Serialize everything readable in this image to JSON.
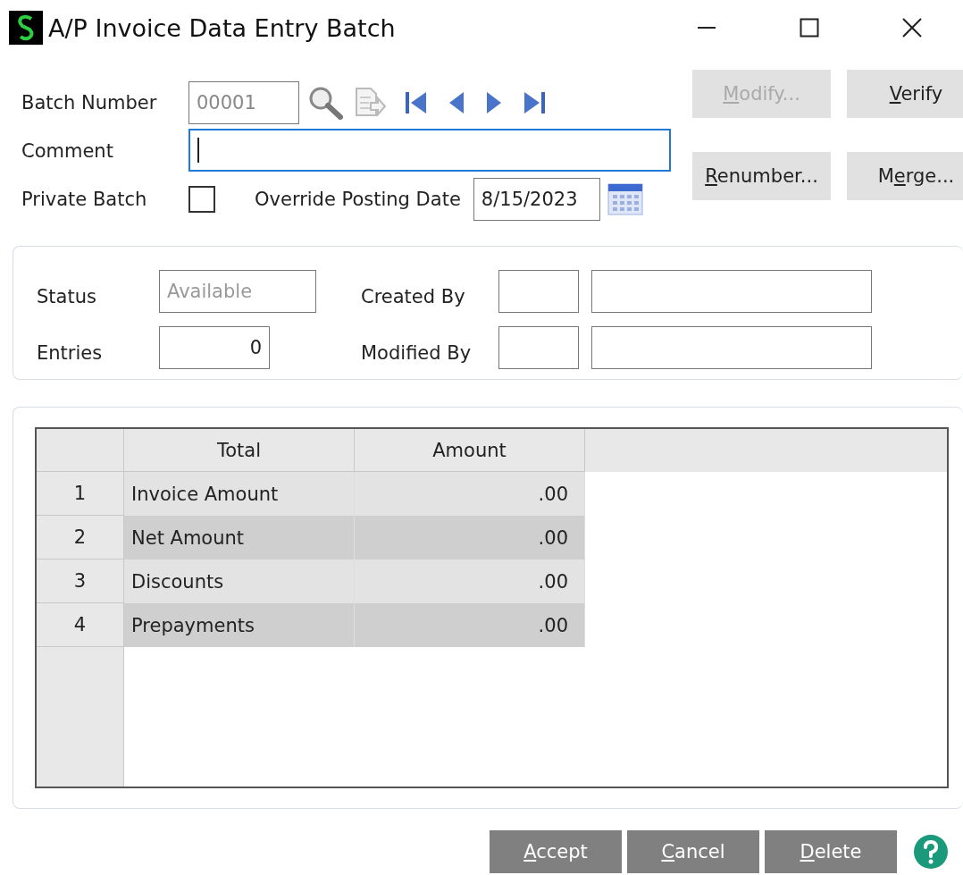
{
  "window": {
    "title": "A/P Invoice Data Entry Batch"
  },
  "header": {
    "batch_number": {
      "label": "Batch Number",
      "value": "00001"
    },
    "comment": {
      "label": "Comment"
    },
    "private_batch": {
      "label": "Private Batch",
      "checked": false
    },
    "override_posting_date": {
      "label": "Override Posting Date",
      "value": "8/15/2023"
    }
  },
  "side_buttons": [
    {
      "key": "M",
      "post": "odify...",
      "disabled": true
    },
    {
      "key": "V",
      "post": "erify",
      "disabled": false
    },
    {
      "key": "R",
      "post": "enumber...",
      "disabled": false
    },
    {
      "pre": "M",
      "key": "e",
      "post": "rge...",
      "disabled": false
    }
  ],
  "info": {
    "status": {
      "label": "Status",
      "value": "Available"
    },
    "entries": {
      "label": "Entries",
      "value": "0"
    },
    "created_by": {
      "label": "Created By"
    },
    "modified_by": {
      "label": "Modified By"
    }
  },
  "table": {
    "columns": [
      "Total",
      "Amount"
    ],
    "rows": [
      {
        "number": "1",
        "total": "Invoice Amount",
        "amount": ".00"
      },
      {
        "number": "2",
        "total": "Net Amount",
        "amount": ".00"
      },
      {
        "number": "3",
        "total": "Discounts",
        "amount": ".00"
      },
      {
        "number": "4",
        "total": "Prepayments",
        "amount": ".00"
      }
    ]
  },
  "footer_buttons": [
    {
      "key": "A",
      "post": "ccept"
    },
    {
      "key": "C",
      "post": "ancel"
    },
    {
      "key": "D",
      "post": "elete"
    }
  ]
}
